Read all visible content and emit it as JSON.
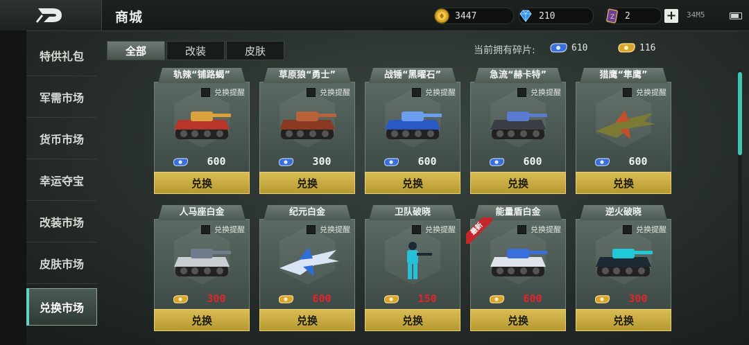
{
  "header": {
    "title": "商城",
    "currencies": [
      {
        "name": "gold",
        "value": "3447"
      },
      {
        "name": "diamond",
        "value": "210"
      },
      {
        "name": "card",
        "value": "2"
      }
    ],
    "status": "34M5"
  },
  "sidebar": {
    "items": [
      {
        "label": "特供礼包"
      },
      {
        "label": "军需市场"
      },
      {
        "label": "货币市场"
      },
      {
        "label": "幸运夺宝"
      },
      {
        "label": "改装市场"
      },
      {
        "label": "皮肤市场"
      },
      {
        "label": "兑换市场",
        "active": true
      }
    ]
  },
  "tabs": [
    {
      "label": "全部",
      "active": true
    },
    {
      "label": "改装"
    },
    {
      "label": "皮肤"
    }
  ],
  "shards": {
    "label": "当前拥有碎片:",
    "blue": "610",
    "gold": "116"
  },
  "cards": [
    {
      "name": "轨辣“铺路蝎”",
      "remind": "兑换提醒",
      "price": "600",
      "currency": "blue",
      "button": "兑换",
      "art": "tank-red"
    },
    {
      "name": "草原狼“勇士”",
      "remind": "兑换提醒",
      "price": "300",
      "currency": "blue",
      "button": "兑换",
      "art": "tank-rust"
    },
    {
      "name": "战锤“黑曜石”",
      "remind": "兑换提醒",
      "price": "600",
      "currency": "blue",
      "button": "兑换",
      "art": "tank-blue"
    },
    {
      "name": "急流“赫卡特”",
      "remind": "兑换提醒",
      "price": "600",
      "currency": "blue",
      "button": "兑换",
      "art": "tank-dark"
    },
    {
      "name": "猎鹰“隼鹰”",
      "remind": "兑换提醒",
      "price": "600",
      "currency": "blue",
      "button": "兑换",
      "art": "jet"
    },
    {
      "name": "人马座白金",
      "remind": "兑换提醒",
      "price": "300",
      "currency": "gold",
      "button": "兑换",
      "art": "tank-white"
    },
    {
      "name": "纪元白金",
      "remind": "兑换提醒",
      "price": "600",
      "currency": "gold",
      "button": "兑换",
      "art": "plane-white"
    },
    {
      "name": "卫队破晓",
      "remind": "兑换提醒",
      "price": "150",
      "currency": "gold",
      "button": "兑换",
      "art": "soldier"
    },
    {
      "name": "能量盾白金",
      "remind": "兑换提醒",
      "price": "600",
      "currency": "gold",
      "button": "兑换",
      "art": "tank-silver",
      "ribbon": "最新"
    },
    {
      "name": "逆火破晓",
      "remind": "兑换提醒",
      "price": "300",
      "currency": "gold",
      "button": "兑换",
      "art": "tank-cyan"
    }
  ],
  "colors": {
    "accent": "#3ec6b3",
    "button": "#c9ad42",
    "price_red": "#e0242c"
  }
}
